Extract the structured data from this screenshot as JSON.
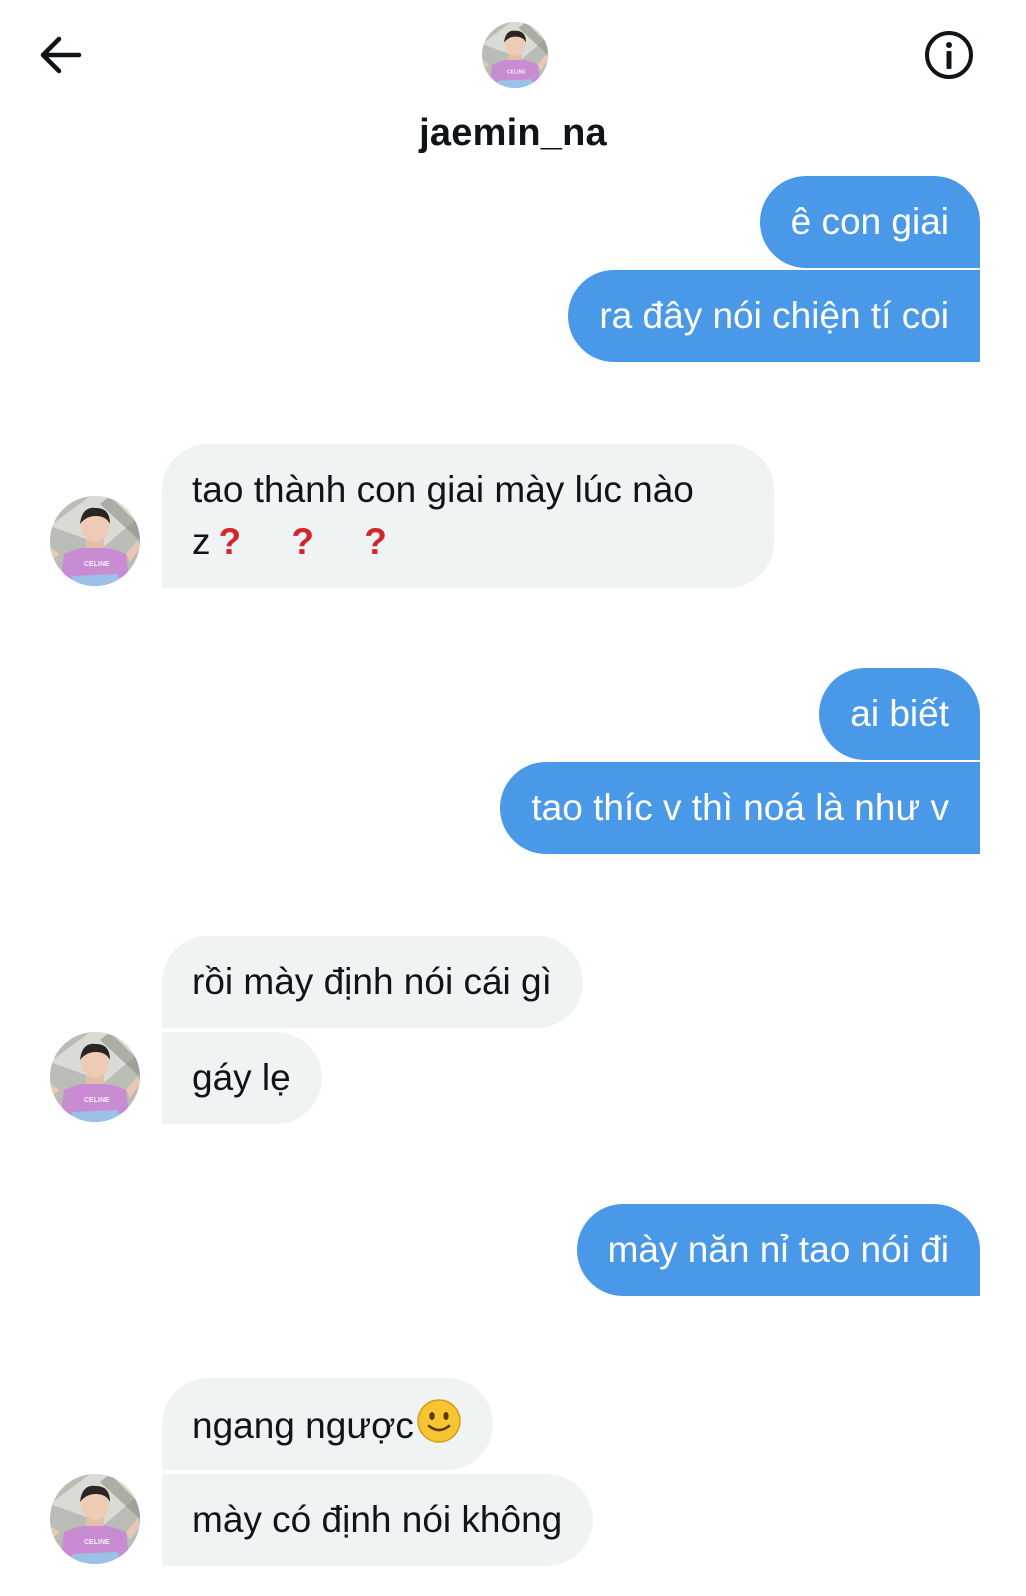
{
  "header": {
    "back_icon": "arrow-left-icon",
    "info_icon": "info-icon",
    "username": "jaemin_na",
    "avatar_shirt_text": "CELINE"
  },
  "colors": {
    "outgoing_bubble": "#4a99e9",
    "incoming_bubble": "#eff3f4",
    "question_marks": "#d1272c"
  },
  "messages": [
    {
      "id": "m1",
      "side": "out",
      "text": "ê con giai"
    },
    {
      "id": "m2",
      "side": "out",
      "text": "ra đây nói chiện tí coi"
    },
    {
      "id": "m3",
      "side": "in",
      "text": "tao thành con giai mày lúc nào z",
      "suffix": "? ? ?"
    },
    {
      "id": "m4",
      "side": "out",
      "text": "ai biết"
    },
    {
      "id": "m5",
      "side": "out",
      "text": "tao thíc v thì noá là như v"
    },
    {
      "id": "m6",
      "side": "in",
      "text": "rồi mày định nói cái gì"
    },
    {
      "id": "m7",
      "side": "in",
      "text": "gáy lẹ"
    },
    {
      "id": "m8",
      "side": "out",
      "text": "mày năn nỉ tao nói đi"
    },
    {
      "id": "m9",
      "side": "in",
      "text": "ngang ngược",
      "emoji": "slightly-smiling-face-icon"
    },
    {
      "id": "m10",
      "side": "in",
      "text": "mày có định nói không"
    }
  ]
}
